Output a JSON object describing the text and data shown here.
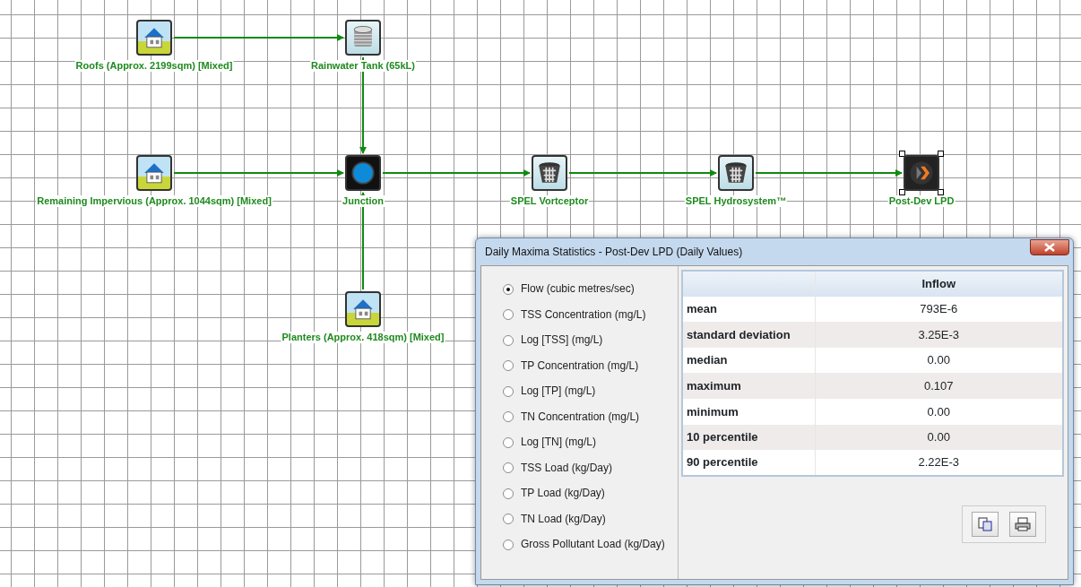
{
  "diagram": {
    "nodes": [
      {
        "kind": "house",
        "label": "Roofs (Approx. 2199sqm) [Mixed]",
        "selected": false
      },
      {
        "kind": "tank",
        "label": "Rainwater Tank (65kL)",
        "selected": false
      },
      {
        "kind": "house",
        "label": "Remaining Impervious (Approx. 1044sqm) [Mixed]",
        "selected": false
      },
      {
        "kind": "junction",
        "label": "Junction",
        "selected": false
      },
      {
        "kind": "house",
        "label": "Planters (Approx. 418sqm) [Mixed]",
        "selected": false
      },
      {
        "kind": "filter",
        "label": "SPEL Vortceptor",
        "selected": false
      },
      {
        "kind": "filter",
        "label": "SPEL Hydrosystem™",
        "selected": false
      },
      {
        "kind": "outlet",
        "label": "Post-Dev LPD",
        "selected": true
      }
    ]
  },
  "dialog": {
    "title": "Daily Maxima Statistics - Post-Dev LPD (Daily Values)",
    "options": [
      {
        "label": "Flow (cubic metres/sec)",
        "selected": true
      },
      {
        "label": "TSS Concentration (mg/L)",
        "selected": false
      },
      {
        "label": "Log [TSS] (mg/L)",
        "selected": false
      },
      {
        "label": "TP Concentration (mg/L)",
        "selected": false
      },
      {
        "label": "Log [TP] (mg/L)",
        "selected": false
      },
      {
        "label": "TN Concentration (mg/L)",
        "selected": false
      },
      {
        "label": "Log [TN] (mg/L)",
        "selected": false
      },
      {
        "label": "TSS Load (kg/Day)",
        "selected": false
      },
      {
        "label": "TP Load (kg/Day)",
        "selected": false
      },
      {
        "label": "TN Load (kg/Day)",
        "selected": false
      },
      {
        "label": "Gross Pollutant Load (kg/Day)",
        "selected": false
      }
    ],
    "table": {
      "columns": [
        "Inflow"
      ],
      "rows": [
        {
          "label": "mean",
          "value": "793E-6"
        },
        {
          "label": "standard deviation",
          "value": "3.25E-3"
        },
        {
          "label": "median",
          "value": "0.00"
        },
        {
          "label": "maximum",
          "value": "0.107"
        },
        {
          "label": "minimum",
          "value": "0.00"
        },
        {
          "label": "10 percentile",
          "value": "0.00"
        },
        {
          "label": "90 percentile",
          "value": "2.22E-3"
        }
      ]
    }
  }
}
